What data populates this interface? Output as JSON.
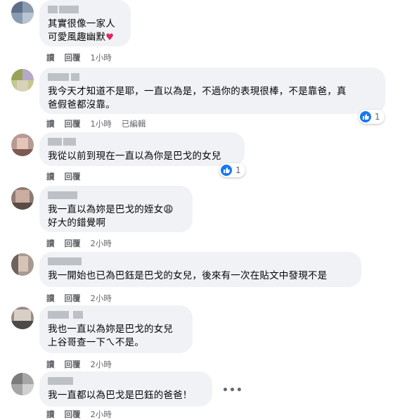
{
  "actions": {
    "reply": "回覆",
    "read": "讀",
    "edited": "已編輯",
    "more": "•••"
  },
  "comments": [
    {
      "lines": "其實很像一家人\n可愛風趣幽默",
      "time": "1小時",
      "heart": "♥"
    },
    {
      "lines": "我今天才知道不是耶，一直以為是，不過你的表現很棒，不是靠爸，真\n爸假爸都沒靠。",
      "time": "1小時",
      "reactions": "1"
    },
    {
      "lines": "我從以前到現在一直以為你是巴戈的女兒",
      "reactions": "1"
    },
    {
      "lines": "我一直以為妳是巴戈的姪女😩\n好大的錯覺啊",
      "time": "2小時"
    },
    {
      "lines": "我一開始也已為巴鈺是巴戈的女兒，後來有一次在貼文中發現不是",
      "time": "2小時"
    },
    {
      "lines": "我也一直以為妳是巴戈的女兒\n上谷哥查一下ㄟ不是。",
      "time": "2小時"
    },
    {
      "lines": "我一直都以為巴戈是巴鈺的爸爸！",
      "time": "2小時"
    }
  ],
  "colors": {
    "bubble": "#f0f2f5",
    "meta": "#65676b",
    "like": "#1877f2",
    "heart": "#e0245e"
  }
}
